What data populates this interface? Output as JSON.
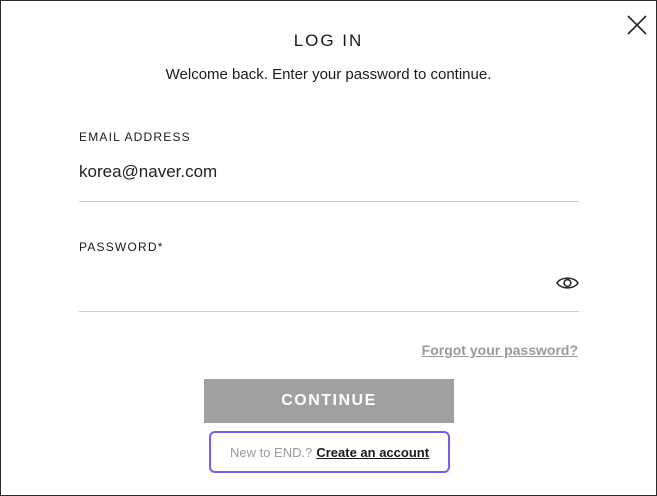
{
  "modal": {
    "title": "LOG IN",
    "subtitle": "Welcome back. Enter your password to continue.",
    "close_icon": "close-icon"
  },
  "email": {
    "label": "EMAIL ADDRESS",
    "value": "korea@naver.com"
  },
  "password": {
    "label": "PASSWORD*",
    "value": "",
    "toggle_icon": "eye-icon"
  },
  "links": {
    "forgot": "Forgot your password?"
  },
  "actions": {
    "continue_label": "CONTINUE"
  },
  "signup": {
    "prompt": "New to END.?",
    "link": "Create an account"
  },
  "colors": {
    "button_bg": "#a0a0a0",
    "highlight_border": "#7b5cf0",
    "muted_text": "#9a9a9a"
  }
}
